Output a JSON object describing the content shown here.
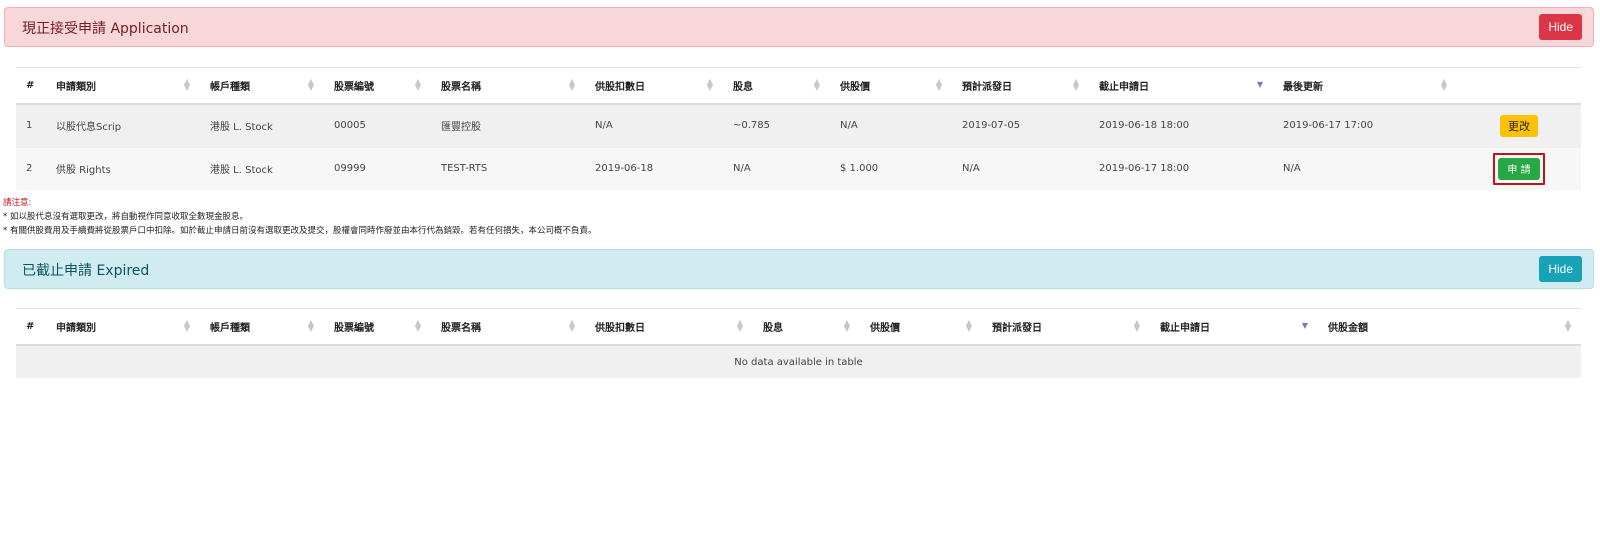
{
  "application_panel": {
    "title": "現正接受申請 Application",
    "hide_label": "Hide"
  },
  "application_table": {
    "headers": [
      "#",
      "申請類別",
      "帳戶種類",
      "股票編號",
      "股票名稱",
      "供股扣數日",
      "股息",
      "供股價",
      "預計派發日",
      "截止申請日",
      "最後更新",
      ""
    ],
    "rows": [
      {
        "no": "1",
        "type": "以股代息Scrip",
        "account": "港股 L. Stock",
        "code": "00005",
        "name": "匯豐控股",
        "deduct_date": "N/A",
        "dividend": "~0.785",
        "price": "N/A",
        "expected_date": "2019-07-05",
        "deadline": "2019-06-18 18:00",
        "updated": "2019-06-17 17:00",
        "action": "更改"
      },
      {
        "no": "2",
        "type": "供股 Rights",
        "account": "港股 L. Stock",
        "code": "09999",
        "name": "TEST-RTS",
        "deduct_date": "2019-06-18",
        "dividend": "N/A",
        "price": "$ 1.000",
        "expected_date": "N/A",
        "deadline": "2019-06-17 18:00",
        "updated": "N/A",
        "action": "申 請"
      }
    ]
  },
  "notes": {
    "title": "請注意:",
    "line1": "* 如以股代息沒有選取更改，將自動視作同意收取全數現金股息。",
    "line2": "* 有關供股費用及手續費將從股票戶口中扣除。如於截止申請日前沒有選取更改及提交，股權會同時作廢並由本行代為銷毀。若有任何損失，本公司概不負責。"
  },
  "expired_panel": {
    "title": "已截止申請 Expired",
    "hide_label": "Hide"
  },
  "expired_table": {
    "headers": [
      "#",
      "申請類別",
      "帳戶種類",
      "股票編號",
      "股票名稱",
      "供股扣數日",
      "股息",
      "供股價",
      "預計派發日",
      "截止申請日",
      "供股金額"
    ],
    "empty_message": "No data available in table"
  },
  "colors": {
    "danger": "#dc3545",
    "info": "#17a2b8",
    "warning": "#ffc107",
    "success": "#28a745",
    "highlight_border": "#c0121b"
  }
}
